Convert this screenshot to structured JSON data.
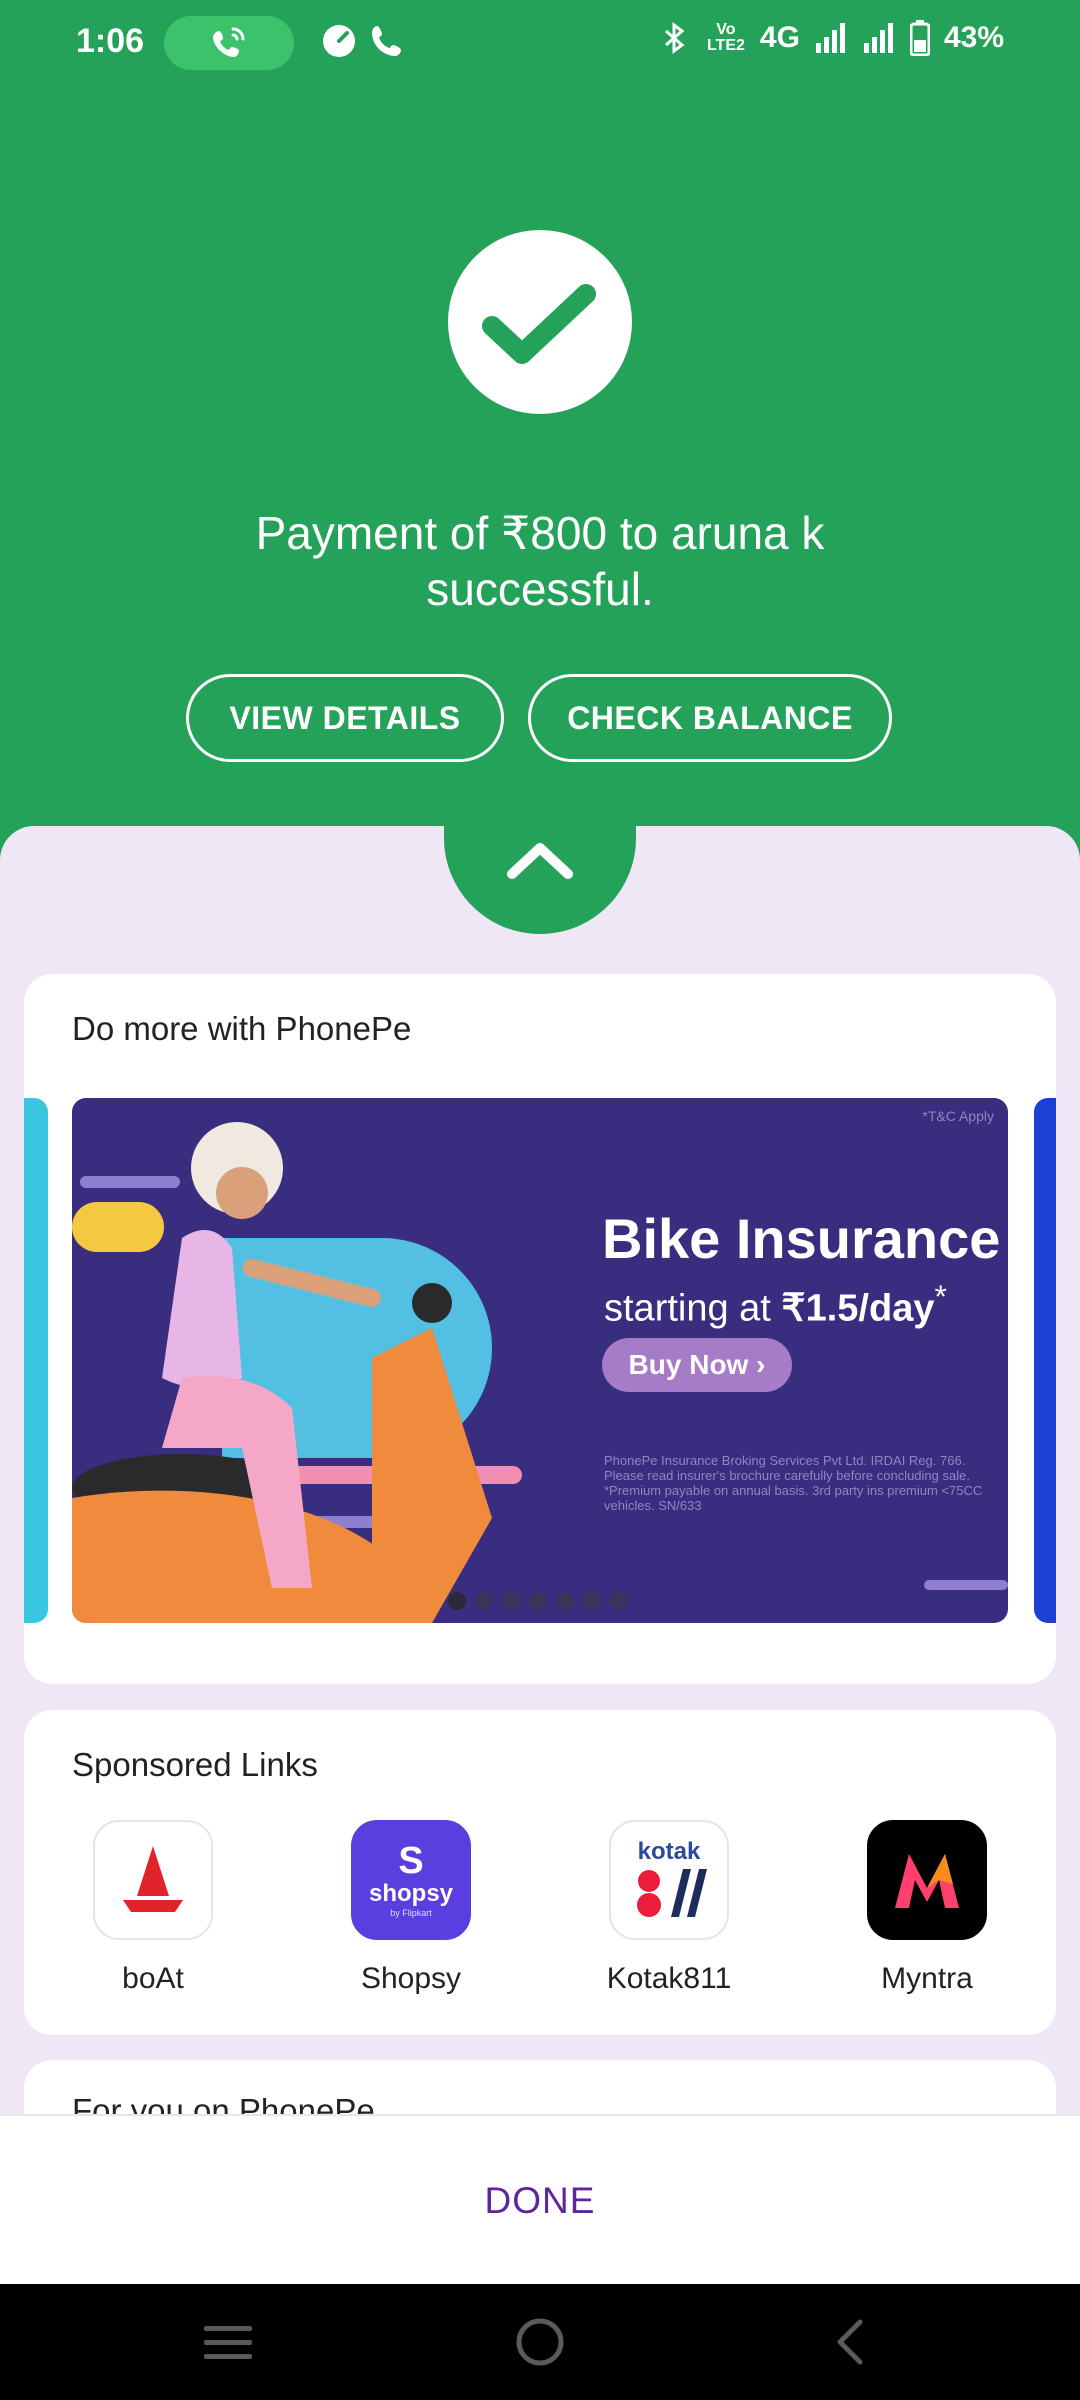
{
  "status_bar": {
    "time": "1:06",
    "network": "4G",
    "lte_badge": "Vo LTE2",
    "battery": "43%"
  },
  "payment": {
    "message": "Payment of ₹800 to aruna k successful.",
    "view_details": "VIEW DETAILS",
    "check_balance": "CHECK BALANCE"
  },
  "promo": {
    "title": "Do more with PhonePe",
    "banner": {
      "heading": "Bike Insurance",
      "sub_prefix": "starting at ",
      "sub_value": "₹1.5/day",
      "sub_suffix": "*",
      "cta": "Buy Now ›",
      "tc": "*T&C Apply",
      "fine_print": "PhonePe Insurance Broking Services Pvt Ltd. IRDAI Reg. 766. Please read insurer's brochure carefully before concluding sale. *Premium payable on annual basis. 3rd party ins premium <75CC vehicles. SN/633",
      "active_dot": 0,
      "dot_count": 7
    }
  },
  "sponsored": {
    "title": "Sponsored Links",
    "apps": [
      {
        "name": "boAt",
        "icon": "boat-logo-icon"
      },
      {
        "name": "Shopsy",
        "icon": "shopsy-logo-icon",
        "logo_text": "S",
        "logo_sub": "shopsy",
        "logo_tag": "by Flipkart"
      },
      {
        "name": "Kotak811",
        "icon": "kotak811-logo-icon",
        "logo_text": "kotak"
      },
      {
        "name": "Myntra",
        "icon": "myntra-logo-icon"
      }
    ]
  },
  "next_card_title": "For you on PhonePe",
  "footer": {
    "done": "DONE"
  },
  "colors": {
    "success_green": "#25a25a",
    "sheet_bg": "#efe6f6",
    "brand_purple": "#5f259f",
    "banner_bg": "#382d7e"
  }
}
